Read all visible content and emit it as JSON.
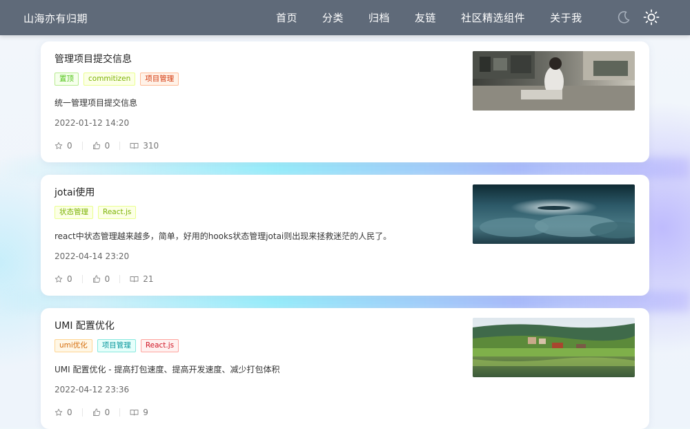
{
  "header": {
    "site_title": "山海亦有归期",
    "nav": [
      "首页",
      "分类",
      "归档",
      "友链",
      "社区精选组件",
      "关于我"
    ],
    "theme_dark_icon": "moon-icon",
    "theme_light_icon": "sun-icon"
  },
  "posts": [
    {
      "title": "管理项目提交信息",
      "tags": [
        {
          "label": "置顶",
          "color": "green"
        },
        {
          "label": "commitizen",
          "color": "lime"
        },
        {
          "label": "项目管理",
          "color": "volcano"
        }
      ],
      "description": "统一管理项目提交信息",
      "date": "2022-01-12 14:20",
      "stars": "0",
      "likes": "0",
      "views": "310",
      "thumb": "office-photo"
    },
    {
      "title": "jotai使用",
      "tags": [
        {
          "label": "状态管理",
          "color": "lime"
        },
        {
          "label": "React.js",
          "color": "lime"
        }
      ],
      "description": "react中状态管理越来越多，简单，好用的hooks状态管理jotai则出现来拯救迷茫的人民了。",
      "date": "2022-04-14 23:20",
      "stars": "0",
      "likes": "0",
      "views": "21",
      "thumb": "clouds-photo"
    },
    {
      "title": "UMI 配置优化",
      "tags": [
        {
          "label": "umi优化",
          "color": "orange"
        },
        {
          "label": "项目管理",
          "color": "cyan"
        },
        {
          "label": "React.js",
          "color": "red"
        }
      ],
      "description": "UMI 配置优化 - 提高打包速度、提高开发速度、减少打包体积",
      "date": "2022-04-12 23:36",
      "stars": "0",
      "likes": "0",
      "views": "9",
      "thumb": "lake-village-photo"
    }
  ]
}
